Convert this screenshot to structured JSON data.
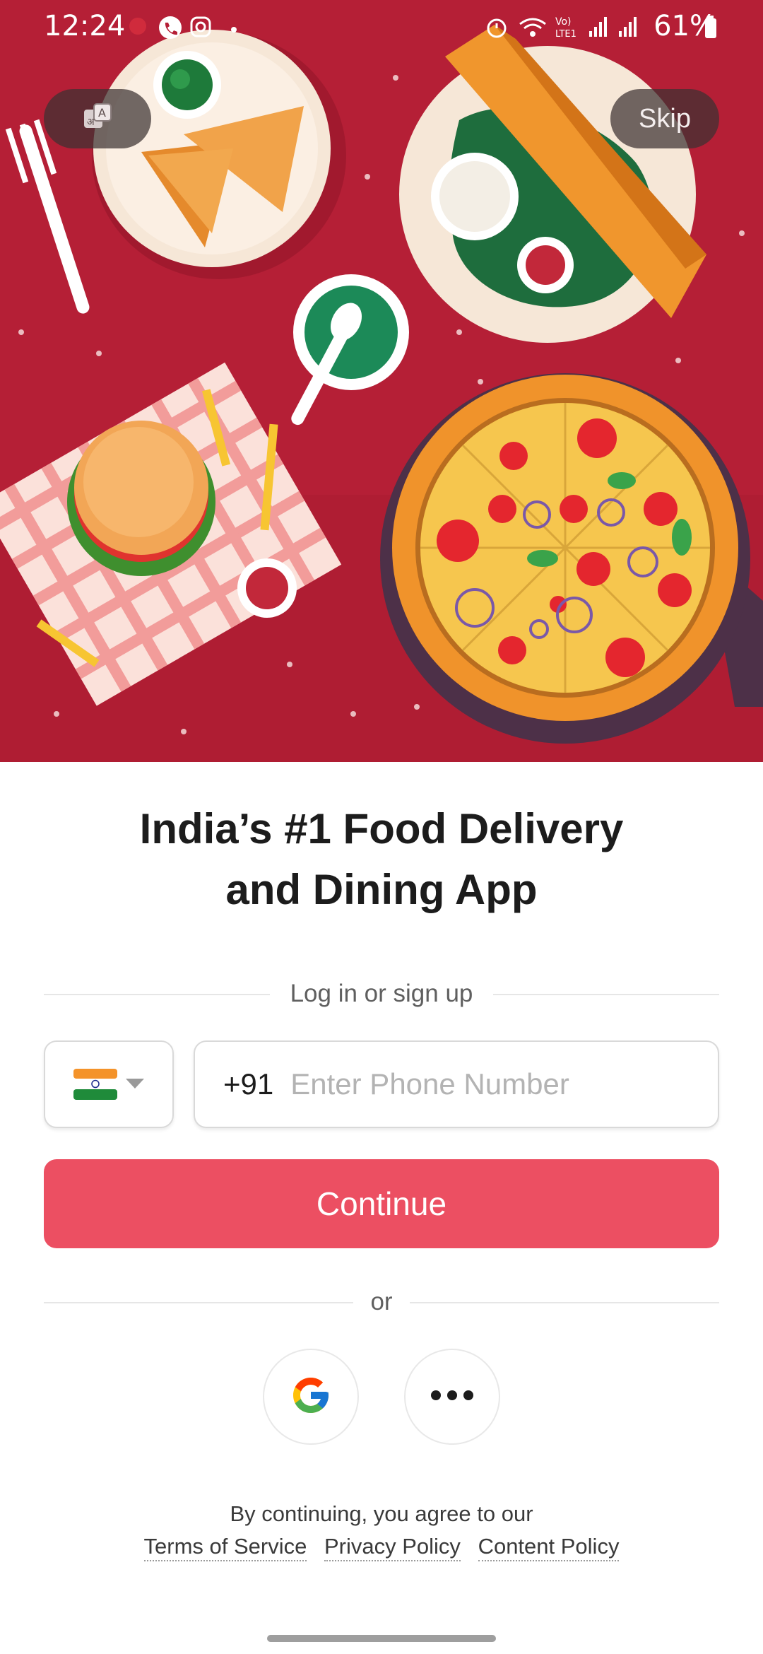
{
  "status_bar": {
    "time": "12:24",
    "battery": "61%"
  },
  "hero": {
    "skip_label": "Skip"
  },
  "headline": {
    "line1": "India’s #1 Food Delivery",
    "line2": "and Dining App"
  },
  "login": {
    "divider_label": "Log in or sign up",
    "country_code": "+91",
    "phone_placeholder": "Enter Phone Number",
    "continue_label": "Continue",
    "or_label": "or"
  },
  "footer": {
    "agree_text": "By continuing, you agree to our",
    "links": [
      "Terms of Service",
      "Privacy Policy",
      "Content Policy"
    ]
  },
  "colors": {
    "accent": "#ec4f62",
    "hero_bg": "#b51f36"
  }
}
